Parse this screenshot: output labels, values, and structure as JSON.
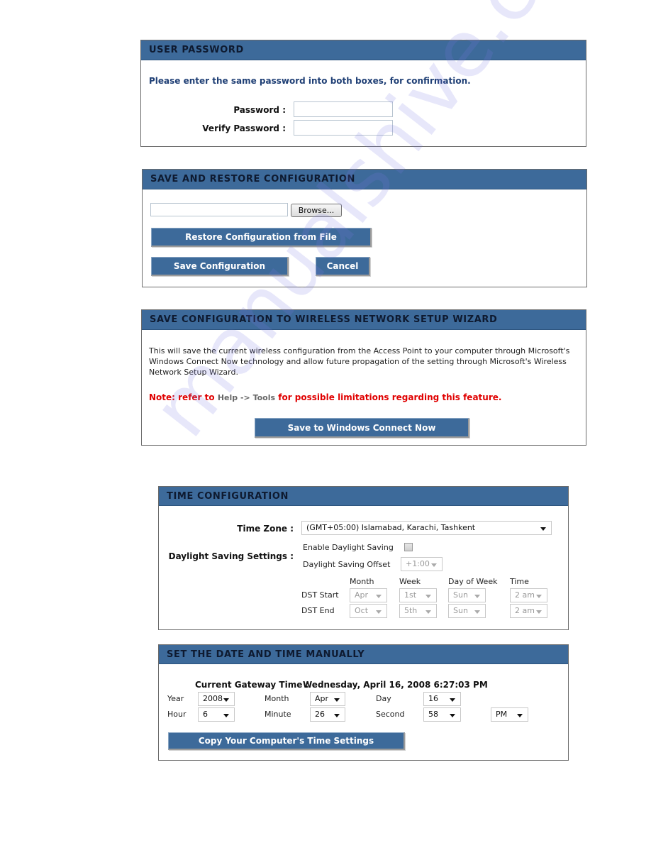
{
  "user_password": {
    "title": "USER PASSWORD",
    "instruction": "Please enter the same password into both boxes, for confirmation.",
    "password_label": "Password :",
    "password_value": "",
    "verify_label": "Verify Password :",
    "verify_value": ""
  },
  "save_restore": {
    "title": "SAVE AND RESTORE CONFIGURATION",
    "file_path_value": "",
    "browse_label": "Browse...",
    "restore_label": "Restore Configuration from File",
    "save_label": "Save Configuration",
    "cancel_label": "Cancel"
  },
  "wizard": {
    "title": "SAVE CONFIGURATION TO WIRELESS NETWORK SETUP WIZARD",
    "description_lines": [
      "This will save the current wireless configuration from the Access Point to your computer through Microsoft's",
      "Windows Connect Now technology and allow future propagation of the setting through Microsoft's Wireless",
      "Network Setup Wizard."
    ],
    "note_prefix": "Note: refer to",
    "note_link": "Help -> Tools",
    "note_suffix": "for possible limitations regarding this feature.",
    "button_label": "Save to Windows Connect Now"
  },
  "time_config": {
    "title": "TIME CONFIGURATION",
    "time_zone_label": "Time Zone :",
    "time_zone_value": "(GMT+05:00) Islamabad, Karachi, Tashkent",
    "dst_settings_label": "Daylight Saving Settings :",
    "enable_dst_label": "Enable Daylight Saving",
    "enable_dst_checked": false,
    "offset_label": "Daylight Saving Offset",
    "offset_value": "+1:00",
    "columns": [
      "Month",
      "Week",
      "Day of Week",
      "Time"
    ],
    "dst_start": {
      "label": "DST Start",
      "month": "Apr",
      "week": "1st",
      "day": "Sun",
      "time": "2 am"
    },
    "dst_end": {
      "label": "DST End",
      "month": "Oct",
      "week": "5th",
      "day": "Sun",
      "time": "2 am"
    }
  },
  "manual_time": {
    "title": "SET THE DATE AND TIME MANUALLY",
    "current_label": "Current Gateway Time :",
    "current_value": "Wednesday, April 16, 2008 6:27:03 PM",
    "year_label": "Year",
    "year_value": "2008",
    "month_label": "Month",
    "month_value": "Apr",
    "day_label": "Day",
    "day_value": "16",
    "hour_label": "Hour",
    "hour_value": "6",
    "minute_label": "Minute",
    "minute_value": "26",
    "second_label": "Second",
    "second_value": "58",
    "ampm_value": "PM",
    "copy_label": "Copy Your Computer's Time Settings"
  },
  "watermark": "manualshive.com",
  "colors": {
    "header_bg": "#3d6a9a",
    "header_text": "#0e1a30",
    "instruction_text": "#1f3f75",
    "note_red": "#e00000",
    "note_gray": "#666666"
  }
}
